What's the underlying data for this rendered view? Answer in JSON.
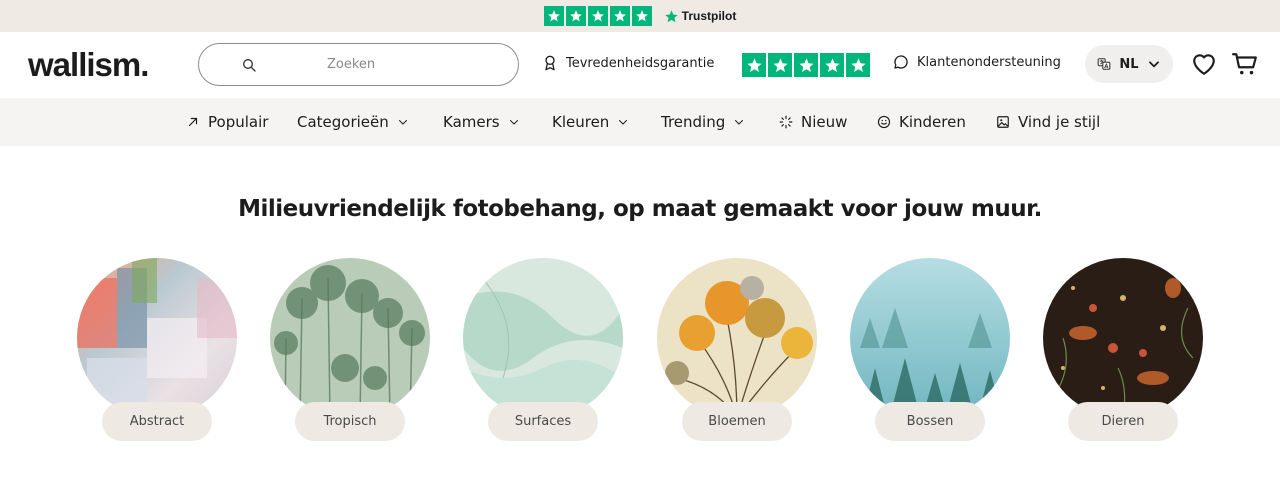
{
  "trustbar": {
    "brand": "Trustpilot",
    "stars": 5
  },
  "header": {
    "logo": "wallism.",
    "search_placeholder": "Zoeken",
    "guarantee": "Tevredenheidsgarantie",
    "support": "Klantenondersteuning",
    "language": "NL"
  },
  "nav": {
    "items": [
      {
        "label": "Populair"
      },
      {
        "label": "Categorieën"
      },
      {
        "label": "Kamers"
      },
      {
        "label": "Kleuren"
      },
      {
        "label": "Trending"
      },
      {
        "label": "Nieuw"
      },
      {
        "label": "Kinderen"
      },
      {
        "label": "Vind je stijl"
      }
    ]
  },
  "main": {
    "headline": "Milieuvriendelijk fotobehang, op maat gemaakt voor jouw muur.",
    "categories": [
      {
        "label": "Abstract"
      },
      {
        "label": "Tropisch"
      },
      {
        "label": "Surfaces"
      },
      {
        "label": "Bloemen"
      },
      {
        "label": "Bossen"
      },
      {
        "label": "Dieren"
      }
    ]
  },
  "colors": {
    "trustpilot_green": "#00b67a",
    "topbar_bg": "#efeae4",
    "nav_bg": "#f5f4f2",
    "pill_bg": "#eee9e3"
  }
}
